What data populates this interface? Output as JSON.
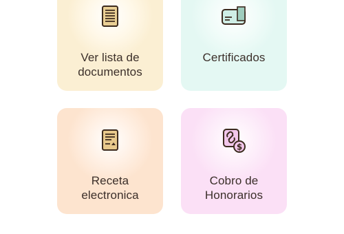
{
  "cards": [
    {
      "icon": "document-list-icon",
      "label_lines": [
        "Ver lista de",
        "documentos"
      ],
      "bg": "#fbefd3"
    },
    {
      "icon": "certificate-icon",
      "label_lines": [
        "Certificados"
      ],
      "bg": "#e4f8f3"
    },
    {
      "icon": "prescription-icon",
      "label_lines": [
        "Receta",
        "electronica"
      ],
      "bg": "#fde4cf"
    },
    {
      "icon": "billing-link-icon",
      "label_lines": [
        "Cobro de",
        "Honorarios"
      ],
      "bg": "#fbe0f6"
    }
  ],
  "colors": {
    "icon_stroke": "#3b2a1e",
    "icon_fill_doc": "#e9cf95",
    "icon_fill_cert": "#cfeee6",
    "icon_fill_rx": "#e7c98c",
    "icon_fill_bill": "#f2c6eb",
    "text": "#3b2f2a"
  }
}
